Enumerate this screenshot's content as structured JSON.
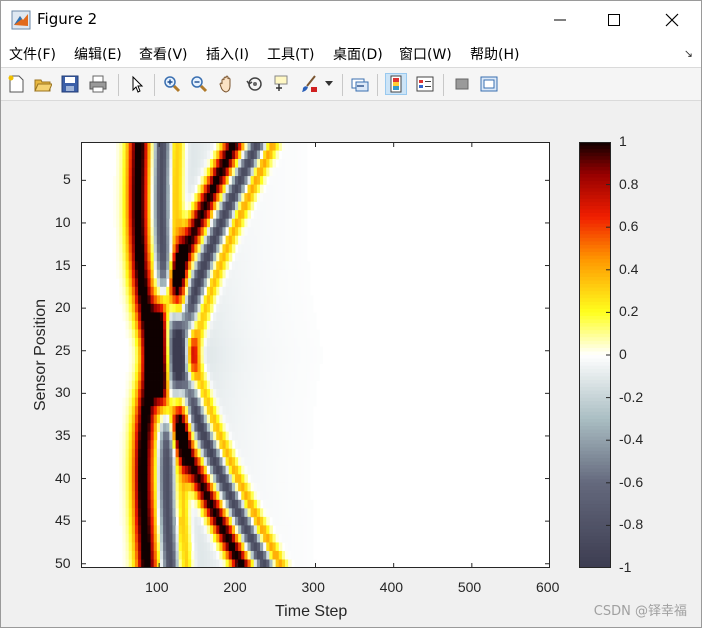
{
  "window": {
    "title": "Figure 2"
  },
  "menu": [
    "文件(F)",
    "编辑(E)",
    "查看(V)",
    "插入(I)",
    "工具(T)",
    "桌面(D)",
    "窗口(W)",
    "帮助(H)"
  ],
  "toolbar": {
    "icons": [
      "new-figure-icon",
      "open-file-icon",
      "save-icon",
      "print-icon",
      "pointer-icon",
      "zoom-in-icon",
      "zoom-out-icon",
      "pan-icon",
      "rotate-3d-icon",
      "data-cursor-icon",
      "brush-icon",
      "link-plot-icon",
      "insert-colorbar-icon",
      "insert-legend-icon",
      "hide-plot-tools-icon",
      "show-plot-tools-icon"
    ]
  },
  "chart_data": {
    "type": "heatmap",
    "title": "",
    "xlabel": "Time Step",
    "ylabel": "Sensor Position",
    "xlim": [
      0,
      600
    ],
    "ylim": [
      1,
      50
    ],
    "y_reversed": true,
    "x_ticks": [
      "100",
      "200",
      "300",
      "400",
      "500",
      "600"
    ],
    "y_ticks": [
      "5",
      "10",
      "15",
      "20",
      "25",
      "30",
      "35",
      "40",
      "45",
      "50"
    ],
    "colorbar": {
      "ticks": [
        "1",
        "0.8",
        "0.6",
        "0.4",
        "0.2",
        "0",
        "-0.2",
        "-0.4",
        "-0.6",
        "-0.8",
        "-1"
      ],
      "clim": [
        -1,
        1
      ],
      "colormap": "hot-to-bone diverging"
    },
    "wave_fronts": [
      {
        "sensor_start": 1,
        "time_start": 80,
        "sensor_end": 50,
        "time_end": 210
      },
      {
        "sensor_start": 50,
        "time_start": 90,
        "sensor_end": 1,
        "time_end": 200
      }
    ]
  },
  "watermark": "CSDN @铎幸福"
}
